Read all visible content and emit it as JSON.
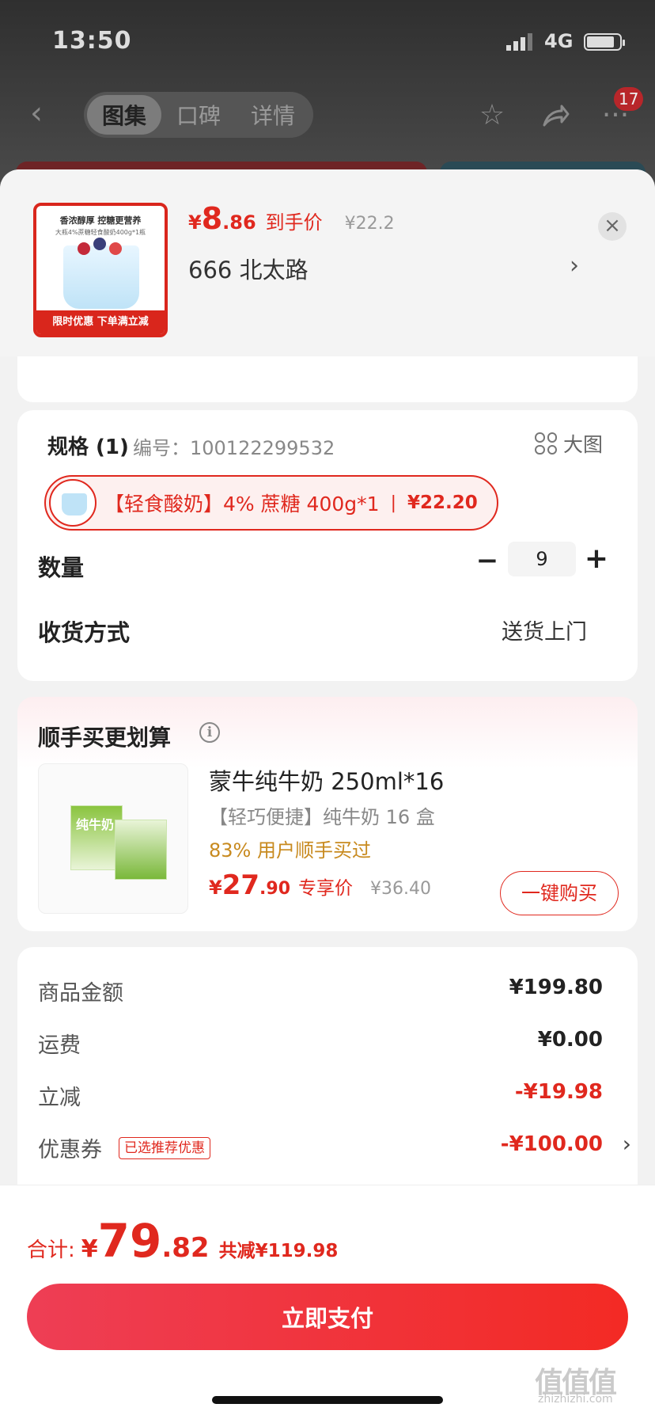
{
  "status_bar": {
    "time": "13:50",
    "network": "4G"
  },
  "nav": {
    "tabs": [
      {
        "label": "图集",
        "active": true
      },
      {
        "label": "口碑"
      },
      {
        "label": "详情"
      }
    ],
    "badge_count": "17"
  },
  "product": {
    "thumb_title": "香浓醇厚 控糖更营养",
    "thumb_sub": "大瓶4%蔗糖轻食酸奶400g*1瓶",
    "thumb_banner": "限时优惠 下单满立减",
    "price_currency": "¥",
    "price_int": "8",
    "price_dec": ".86",
    "price_label": "到手价",
    "orig_price": "¥22.2",
    "address": "666  北太路"
  },
  "spec": {
    "title": "规格 (1)",
    "code": "编号：100122299532",
    "big_image_label": "大图",
    "option_text": "【轻食酸奶】4% 蔗糖 400g*1",
    "option_sep": "|",
    "option_price": "¥22.20",
    "qty_label": "数量",
    "qty_value": "9",
    "ship_label": "收货方式",
    "ship_value": "送货上门"
  },
  "upsell": {
    "title": "顺手买更划算",
    "box_text": "纯牛奶",
    "name": "蒙牛纯牛奶 250ml*16",
    "desc": "【轻巧便捷】纯牛奶 16 盒",
    "rate": "83% 用户顺手买过",
    "price_currency": "¥",
    "price_int": "27",
    "price_dec": ".90",
    "price_label": "专享价",
    "orig_price": "¥36.40",
    "button": "一键购买"
  },
  "summary": {
    "rows": [
      {
        "label": "商品金额",
        "value": "¥199.80"
      },
      {
        "label": "运费",
        "value": "¥0.00"
      },
      {
        "label": "立减",
        "value": "-¥19.98"
      },
      {
        "label": "优惠券",
        "tag": "已选推荐优惠",
        "value": "-¥100.00"
      }
    ]
  },
  "footer": {
    "total_label": "合计:",
    "currency": "¥",
    "total_int": "79",
    "total_dec": ".82",
    "save_text": "共减¥119.98",
    "pay_button": "立即支付"
  },
  "watermark": {
    "main": "值值值",
    "site": "zhizhizhi.com"
  },
  "colors": {
    "accent": "#e0281e",
    "rate": "#c88a1f"
  }
}
